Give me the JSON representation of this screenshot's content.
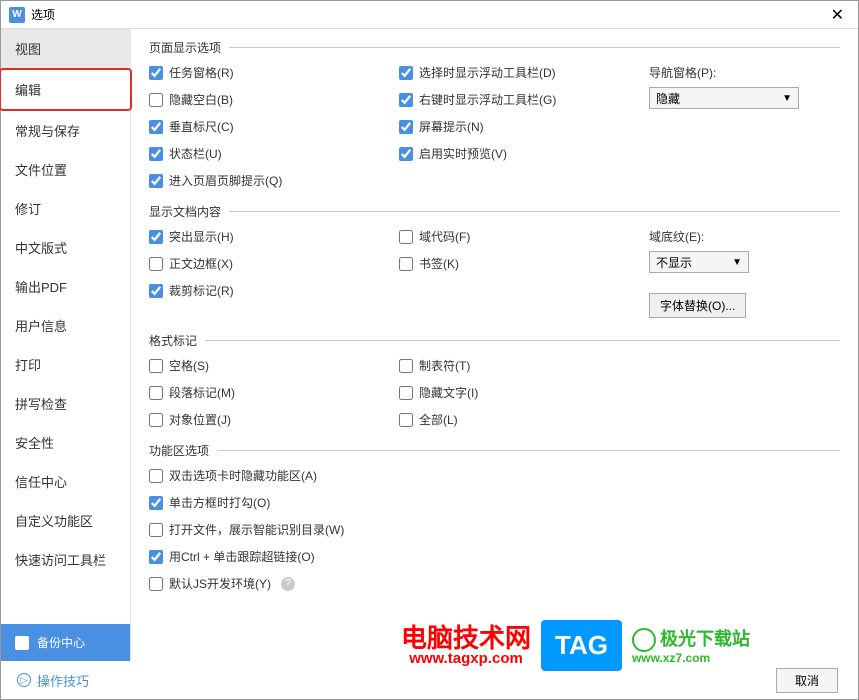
{
  "window": {
    "title": "选项",
    "icon_letter": "W"
  },
  "sidebar": {
    "items": [
      {
        "label": "视图",
        "active": true
      },
      {
        "label": "编辑",
        "highlighted": true
      },
      {
        "label": "常规与保存"
      },
      {
        "label": "文件位置"
      },
      {
        "label": "修订"
      },
      {
        "label": "中文版式"
      },
      {
        "label": "输出PDF"
      },
      {
        "label": "用户信息"
      },
      {
        "label": "打印"
      },
      {
        "label": "拼写检查"
      },
      {
        "label": "安全性"
      },
      {
        "label": "信任中心"
      },
      {
        "label": "自定义功能区"
      },
      {
        "label": "快速访问工具栏"
      }
    ],
    "backup_center": "备份中心"
  },
  "sections": {
    "page_display": {
      "title": "页面显示选项",
      "col1": [
        {
          "label": "任务窗格(R)",
          "checked": true
        },
        {
          "label": "隐藏空白(B)",
          "checked": false
        },
        {
          "label": "垂直标尺(C)",
          "checked": true
        },
        {
          "label": "状态栏(U)",
          "checked": true
        },
        {
          "label": "进入页眉页脚提示(Q)",
          "checked": true
        }
      ],
      "col2": [
        {
          "label": "选择时显示浮动工具栏(D)",
          "checked": true
        },
        {
          "label": "右键时显示浮动工具栏(G)",
          "checked": true
        },
        {
          "label": "屏幕提示(N)",
          "checked": true
        },
        {
          "label": "启用实时预览(V)",
          "checked": true
        }
      ],
      "nav_pane_label": "导航窗格(P):",
      "nav_pane_value": "隐藏"
    },
    "doc_content": {
      "title": "显示文档内容",
      "col1": [
        {
          "label": "突出显示(H)",
          "checked": true
        },
        {
          "label": "正文边框(X)",
          "checked": false
        },
        {
          "label": "裁剪标记(R)",
          "checked": true
        }
      ],
      "col2": [
        {
          "label": "域代码(F)",
          "checked": false
        },
        {
          "label": "书签(K)",
          "checked": false
        }
      ],
      "shading_label": "域底纹(E):",
      "shading_value": "不显示",
      "font_replace_btn": "字体替换(O)..."
    },
    "format_marks": {
      "title": "格式标记",
      "col1": [
        {
          "label": "空格(S)",
          "checked": false
        },
        {
          "label": "段落标记(M)",
          "checked": false
        },
        {
          "label": "对象位置(J)",
          "checked": false
        }
      ],
      "col2": [
        {
          "label": "制表符(T)",
          "checked": false
        },
        {
          "label": "隐藏文字(I)",
          "checked": false
        },
        {
          "label": "全部(L)",
          "checked": false
        }
      ]
    },
    "ribbon_options": {
      "title": "功能区选项",
      "items": [
        {
          "label": "双击选项卡时隐藏功能区(A)",
          "checked": false
        },
        {
          "label": "单击方框时打勾(O)",
          "checked": true
        },
        {
          "label": "打开文件，展示智能识别目录(W)",
          "checked": false
        },
        {
          "label": "用Ctrl + 单击跟踪超链接(O)",
          "checked": true
        },
        {
          "label": "默认JS开发环境(Y)",
          "checked": false,
          "help": true
        }
      ]
    }
  },
  "footer": {
    "tips": "操作技巧",
    "cancel": "取消"
  },
  "watermarks": {
    "wm1_title": "电脑技术网",
    "wm1_url": "www.tagxp.com",
    "wm_tag": "TAG",
    "wm2_title": "极光下载站",
    "wm2_url": "www.xz7.com"
  }
}
